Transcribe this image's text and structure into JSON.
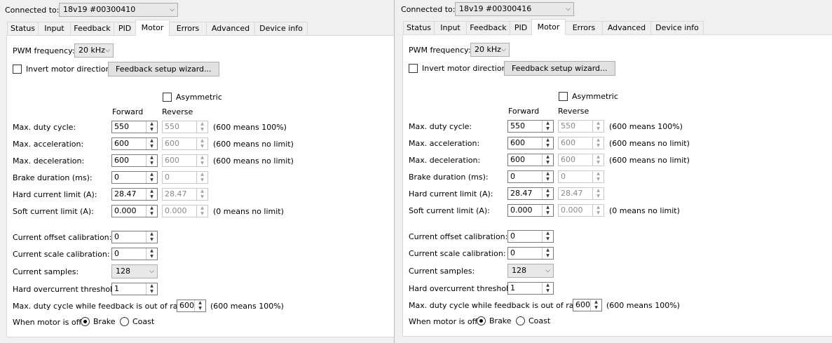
{
  "windows": [
    {
      "connected_label": "Connected to:",
      "device": "18v19 #00300410",
      "tabs": [
        "Status",
        "Input",
        "Feedback",
        "PID",
        "Motor",
        "Errors",
        "Advanced",
        "Device info"
      ],
      "active_tab": "Motor",
      "pwm": {
        "label": "PWM frequency:",
        "value": "20 kHz"
      },
      "invert_label": "Invert motor direction",
      "wizard_button": "Feedback setup wizard...",
      "asymmetric_label": "Asymmetric",
      "col_forward": "Forward",
      "col_reverse": "Reverse",
      "rows": [
        {
          "label": "Max. duty cycle:",
          "forward": "550",
          "reverse": "550",
          "note": "(600 means 100%)"
        },
        {
          "label": "Max. acceleration:",
          "forward": "600",
          "reverse": "600",
          "note": "(600 means no limit)"
        },
        {
          "label": "Max. deceleration:",
          "forward": "600",
          "reverse": "600",
          "note": "(600 means no limit)"
        },
        {
          "label": "Brake duration (ms):",
          "forward": "0",
          "reverse": "0",
          "note": ""
        },
        {
          "label": "Hard current limit (A):",
          "forward": "28.47",
          "reverse": "28.47",
          "note": ""
        },
        {
          "label": "Soft current limit (A):",
          "forward": "0.000",
          "reverse": "0.000",
          "note": "(0 means no limit)"
        }
      ],
      "offset_cal": {
        "label": "Current offset calibration:",
        "value": "0"
      },
      "scale_cal": {
        "label": "Current scale calibration:",
        "value": "0"
      },
      "samples": {
        "label": "Current samples:",
        "value": "128"
      },
      "overcurrent": {
        "label": "Hard overcurrent threshold:",
        "value": "1"
      },
      "duty_oor": {
        "label": "Max. duty cycle while feedback is out of range:",
        "value": "600",
        "note": "(600 means 100%)"
      },
      "motor_off": {
        "label": "When motor is off:",
        "brake": "Brake",
        "coast": "Coast",
        "selected": "Brake"
      }
    },
    {
      "connected_label": "Connected to:",
      "device": "18v19 #00300416",
      "tabs": [
        "Status",
        "Input",
        "Feedback",
        "PID",
        "Motor",
        "Errors",
        "Advanced",
        "Device info"
      ],
      "active_tab": "Motor",
      "pwm": {
        "label": "PWM frequency:",
        "value": "20 kHz"
      },
      "invert_label": "Invert motor direction",
      "wizard_button": "Feedback setup wizard...",
      "asymmetric_label": "Asymmetric",
      "col_forward": "Forward",
      "col_reverse": "Reverse",
      "rows": [
        {
          "label": "Max. duty cycle:",
          "forward": "550",
          "reverse": "550",
          "note": "(600 means 100%)"
        },
        {
          "label": "Max. acceleration:",
          "forward": "600",
          "reverse": "600",
          "note": "(600 means no limit)"
        },
        {
          "label": "Max. deceleration:",
          "forward": "600",
          "reverse": "600",
          "note": "(600 means no limit)"
        },
        {
          "label": "Brake duration (ms):",
          "forward": "0",
          "reverse": "0",
          "note": ""
        },
        {
          "label": "Hard current limit (A):",
          "forward": "28.47",
          "reverse": "28.47",
          "note": ""
        },
        {
          "label": "Soft current limit (A):",
          "forward": "0.000",
          "reverse": "0.000",
          "note": "(0 means no limit)"
        }
      ],
      "offset_cal": {
        "label": "Current offset calibration:",
        "value": "0"
      },
      "scale_cal": {
        "label": "Current scale calibration:",
        "value": "0"
      },
      "samples": {
        "label": "Current samples:",
        "value": "128"
      },
      "overcurrent": {
        "label": "Hard overcurrent threshold:",
        "value": "1"
      },
      "duty_oor": {
        "label": "Max. duty cycle while feedback is out of range:",
        "value": "600",
        "note": "(600 means 100%)"
      },
      "motor_off": {
        "label": "When motor is off:",
        "brake": "Brake",
        "coast": "Coast",
        "selected": "Brake"
      }
    }
  ]
}
